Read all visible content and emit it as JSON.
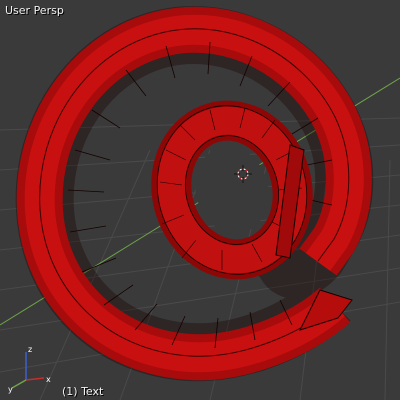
{
  "viewport": {
    "view_label": "User Persp",
    "object_label": "(1) Text",
    "background_color": "#3a3a3a",
    "grid_color": "#4a4a4a",
    "object_color": "#c81010",
    "wire_color": "#150000",
    "axis_colors": {
      "x": "#c03030",
      "y": "#6fa34a",
      "z": "#3c5fd0"
    },
    "icons": [
      "3d-cursor-icon",
      "axis-gizmo-icon"
    ]
  }
}
